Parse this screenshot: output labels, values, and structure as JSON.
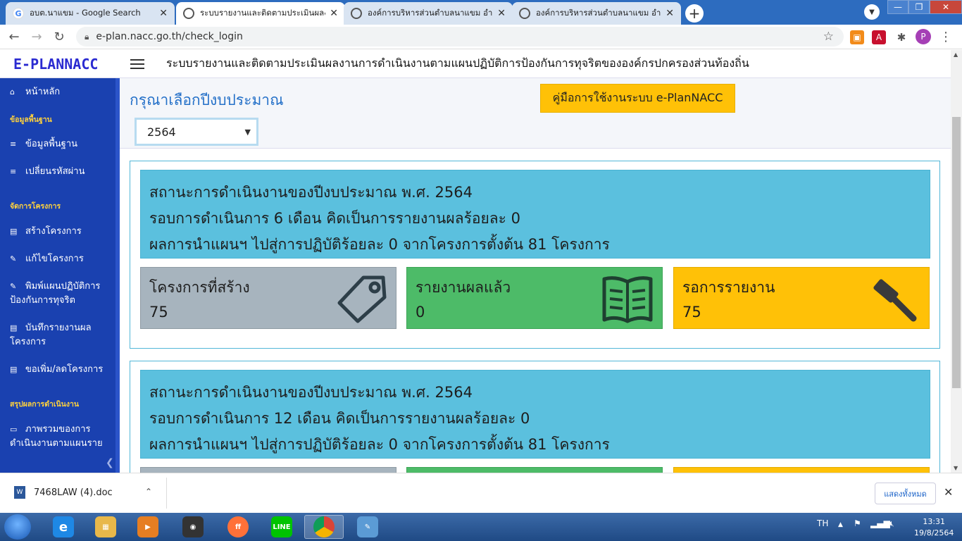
{
  "browser": {
    "tabs": [
      {
        "title": "อบต.นาแขม - Google Search",
        "icon": "google-icon"
      },
      {
        "title": "ระบบรายงานและติดตามประเมินผลงานการดำเนินงาน",
        "icon": "globe-icon"
      },
      {
        "title": "องค์การบริหารส่วนตำบลนาแขม อำเภอ",
        "icon": "globe-icon"
      },
      {
        "title": "องค์การบริหารส่วนตำบลนาแขม อำเภอ",
        "icon": "globe-icon"
      }
    ],
    "url": "e-plan.nacc.go.th/check_login",
    "profile_initial": "P"
  },
  "site": {
    "brand": "E-PLANNACC",
    "system_title": "ระบบรายงานและติดตามประเมินผลงานการดำเนินงานตามแผนปฏิบัติการป้องกันการทุจริตขององค์กรปกครองส่วนท้องถิ่น"
  },
  "sidebar": {
    "home": "หน้าหลัก",
    "section_basic": "ข้อมูลพื้นฐาน",
    "basic_info": "ข้อมูลพื้นฐาน",
    "change_password": "เปลี่ยนรหัสผ่าน",
    "section_projects": "จัดการโครงการ",
    "create_project": "สร้างโครงการ",
    "edit_project": "แก้ไขโครงการ",
    "print_plan_1": "พิมพ์แผนปฏิบัติการ",
    "print_plan_2": "ป้องกันการทุจริต",
    "record_report_1": "บันทึกรายงานผล",
    "record_report_2": "โครงการ",
    "add_remove_project": "ขอเพิ่ม/ลดโครงการ",
    "section_summary": "สรุปผลการดำเนินงาน",
    "overview_1": "ภาพรวมของการ",
    "overview_2": "ดำเนินงานตามแผนราย"
  },
  "main": {
    "page_title": "กรุณาเลือกปีงบประมาณ",
    "manual_button": "คู่มือการใช้งานระบบ e-PlanNACC",
    "year_selected": "2564",
    "cards": [
      {
        "line1": "สถานะการดำเนินงานของปีงบประมาณ พ.ศ. 2564",
        "line2": "รอบการดำเนินการ 6 เดือน คิดเป็นการรายงานผลร้อยละ 0",
        "line3": "ผลการนำแผนฯ ไปสู่การปฏิบัติร้อยละ 0 จากโครงการตั้งต้น 81 โครงการ",
        "created_label": "โครงการที่สร้าง",
        "created_value": "75",
        "reported_label": "รายงานผลแล้ว",
        "reported_value": "0",
        "pending_label": "รอการรายงาน",
        "pending_value": "75"
      },
      {
        "line1": "สถานะการดำเนินงานของปีงบประมาณ พ.ศ. 2564",
        "line2": "รอบการดำเนินการ 12 เดือน คิดเป็นการรายงานผลร้อยละ 0",
        "line3": "ผลการนำแผนฯ ไปสู่การปฏิบัติร้อยละ 0 จากโครงการตั้งต้น 81 โครงการ"
      }
    ]
  },
  "download_bar": {
    "file_name": "7468LAW (4).doc",
    "show_all": "แสดงทั้งหมด"
  },
  "taskbar": {
    "language": "TH",
    "time": "13:31",
    "date": "19/8/2564"
  }
}
